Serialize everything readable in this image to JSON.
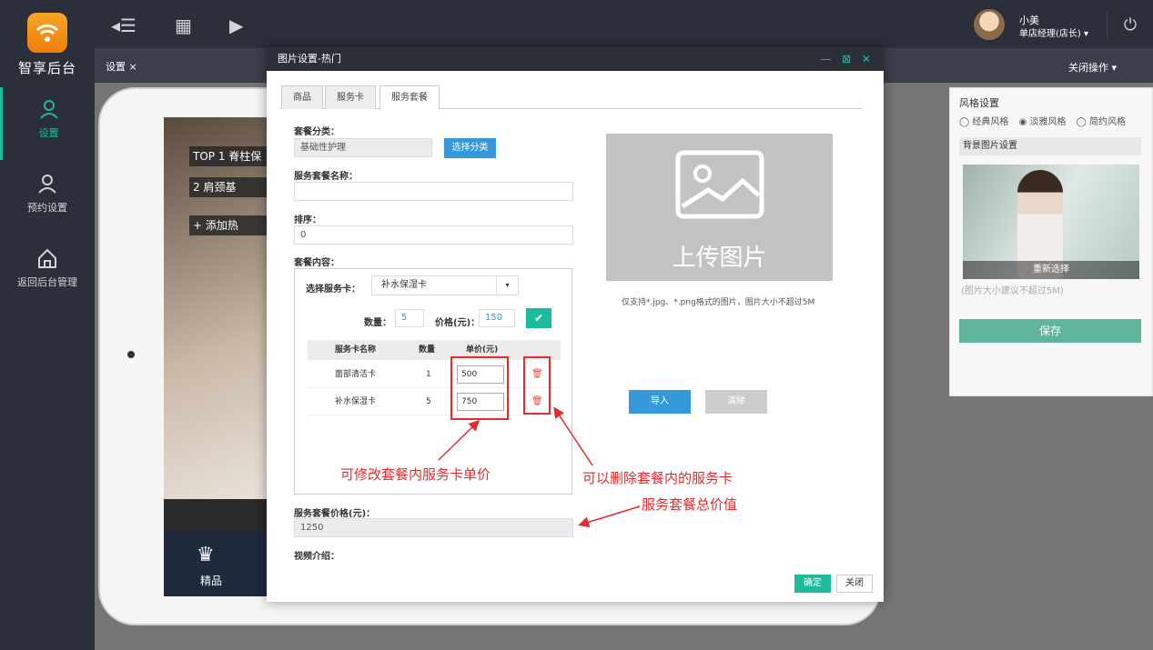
{
  "app": {
    "logo_text": "智享后台"
  },
  "sidebar": {
    "items": [
      {
        "label": "设置"
      },
      {
        "label": "预约设置"
      },
      {
        "label": "返回后台管理"
      }
    ]
  },
  "topbar": {
    "user_name": "小美",
    "user_role": "单店经理(店长) ▾"
  },
  "tabbar": {
    "tab": "设置 ×",
    "close_ops": "关闭操作 ▾"
  },
  "device": {
    "top_items": [
      {
        "rank": "TOP 1",
        "text": "脊柱保"
      },
      {
        "rank": "2",
        "text": "肩颈基"
      },
      {
        "rank": "+",
        "text": "添加热"
      }
    ],
    "bottom_label": "精品"
  },
  "style_panel": {
    "title": "风格设置",
    "options": [
      "◯ 经典风格",
      "◉ 淡雅风格",
      "◯ 简约风格"
    ],
    "bg_title": "背景图片设置",
    "reselect": "重新选择",
    "hint": "(图片大小建议不超过5M)",
    "save": "保存"
  },
  "modal": {
    "title": "图片设置-热门",
    "controls": "— ⊠ ✕",
    "tabs": [
      "商品",
      "服务卡",
      "服务套餐"
    ],
    "category_label": "套餐分类：",
    "category_value": "基础性护理",
    "select_category": "选择分类",
    "name_label": "服务套餐名称：",
    "name_value": "",
    "sort_label": "排序：",
    "sort_value": "0",
    "content_label": "套餐内容：",
    "select_card_label": "选择服务卡：",
    "select_card_value": "补水保湿卡",
    "qty_label": "数量：",
    "qty_value": "5",
    "price_label": "价格(元)：",
    "price_value": "150",
    "table": {
      "headers": [
        "服务卡名称",
        "数量",
        "单价(元)"
      ],
      "rows": [
        {
          "name": "面部清洁卡",
          "qty": "1",
          "price": "500"
        },
        {
          "name": "补水保湿卡",
          "qty": "5",
          "price": "750"
        }
      ]
    },
    "total_label": "服务套餐价格(元)：",
    "total_value": "1250",
    "video_label": "视频介绍：",
    "upload_text": "上传图片",
    "upload_hint": "仅支持*.jpg、*.png格式的图片，图片大小不超过5M",
    "import": "导入",
    "clear": "清除",
    "confirm": "确定",
    "close": "关闭"
  },
  "annotations": {
    "edit_price": "可修改套餐内服务卡单价",
    "delete_card": "可以删除套餐内的服务卡",
    "total_value": "服务套餐总价值"
  }
}
